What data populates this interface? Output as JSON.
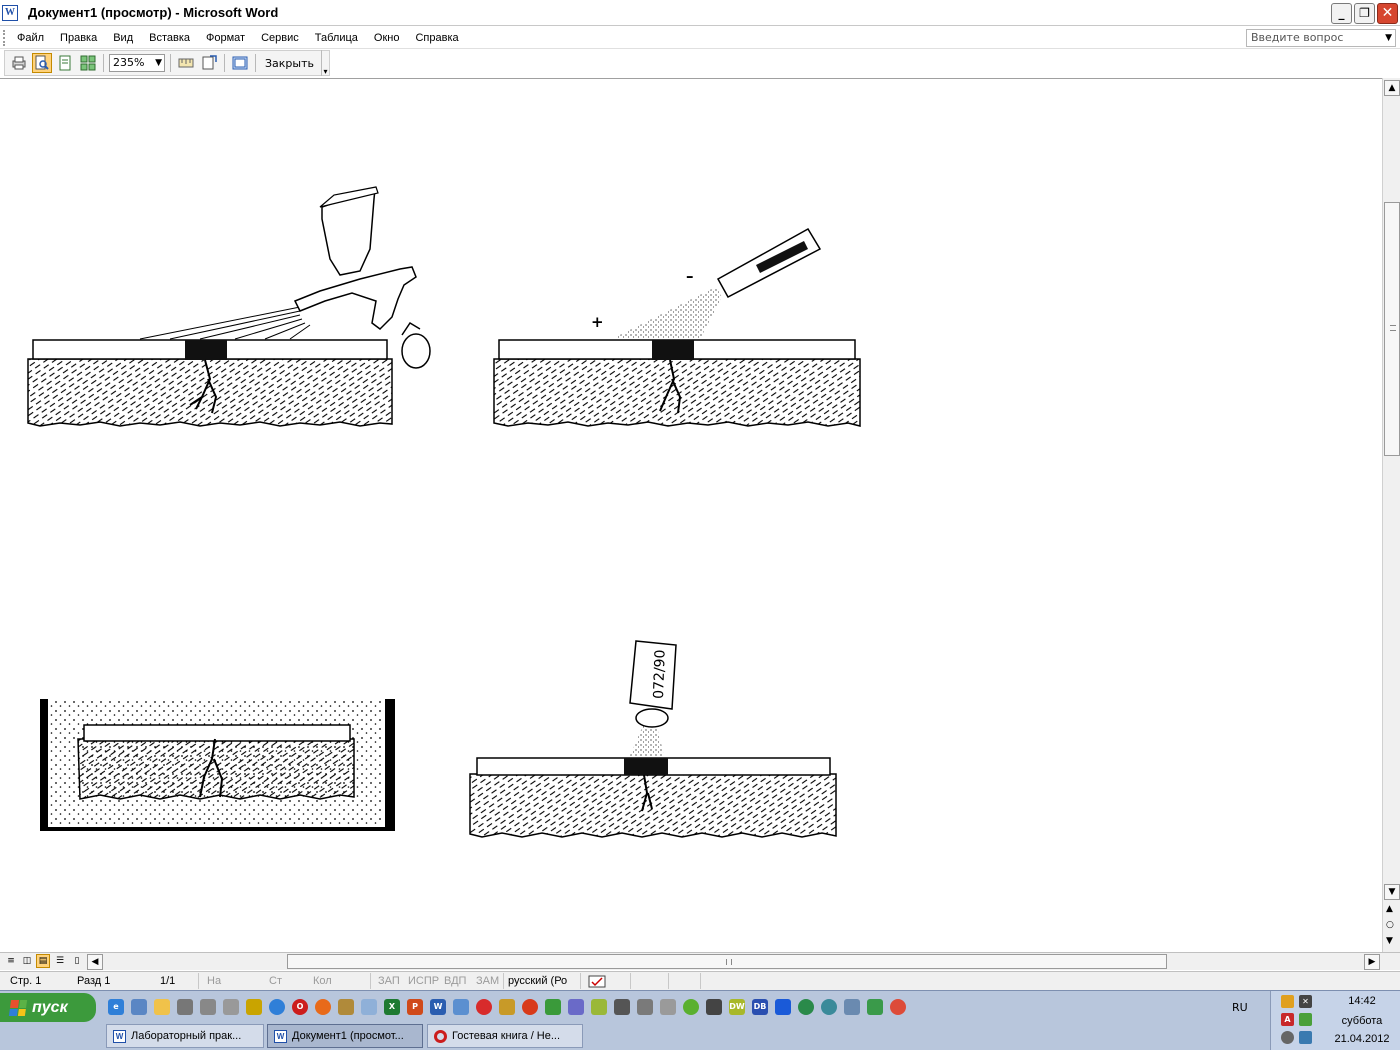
{
  "window": {
    "title": "Документ1 (просмотр) - Microsoft Word",
    "icon": "word-doc-icon"
  },
  "menu": {
    "items": [
      "Файл",
      "Правка",
      "Вид",
      "Вставка",
      "Формат",
      "Сервис",
      "Таблица",
      "Окно",
      "Справка"
    ],
    "ask_placeholder": "Введите вопрос"
  },
  "toolbar": {
    "zoom": "235%",
    "close_label": "Закрыть"
  },
  "document": {
    "figures": [
      {
        "name": "spray-gun-application",
        "text": ""
      },
      {
        "name": "electrostatic-spray",
        "plus": "+",
        "minus": "–"
      },
      {
        "name": "immersion-bath",
        "text": ""
      },
      {
        "name": "aerosol-spray",
        "can_label": "072/90"
      }
    ]
  },
  "statusbar": {
    "page": "Стр. 1",
    "section": "Разд 1",
    "pages": "1/1",
    "at": "На",
    "line": "Ст",
    "col": "Кол",
    "rec": "ЗАП",
    "trk": "ИСПР",
    "ext": "ВДП",
    "ovr": "ЗАМ",
    "language": "русский (Ро"
  },
  "taskbar": {
    "start_label": "пуск",
    "tasks": [
      {
        "label": "Лабораторный прак...",
        "active": false,
        "icon": "word"
      },
      {
        "label": "Документ1 (просмот...",
        "active": true,
        "icon": "word"
      },
      {
        "label": "Гостевая книга / Не...",
        "active": false,
        "icon": "opera"
      }
    ],
    "lang_indicator": "RU",
    "clock_time": "14:42",
    "clock_day": "суббота",
    "clock_date": "21.04.2012"
  }
}
